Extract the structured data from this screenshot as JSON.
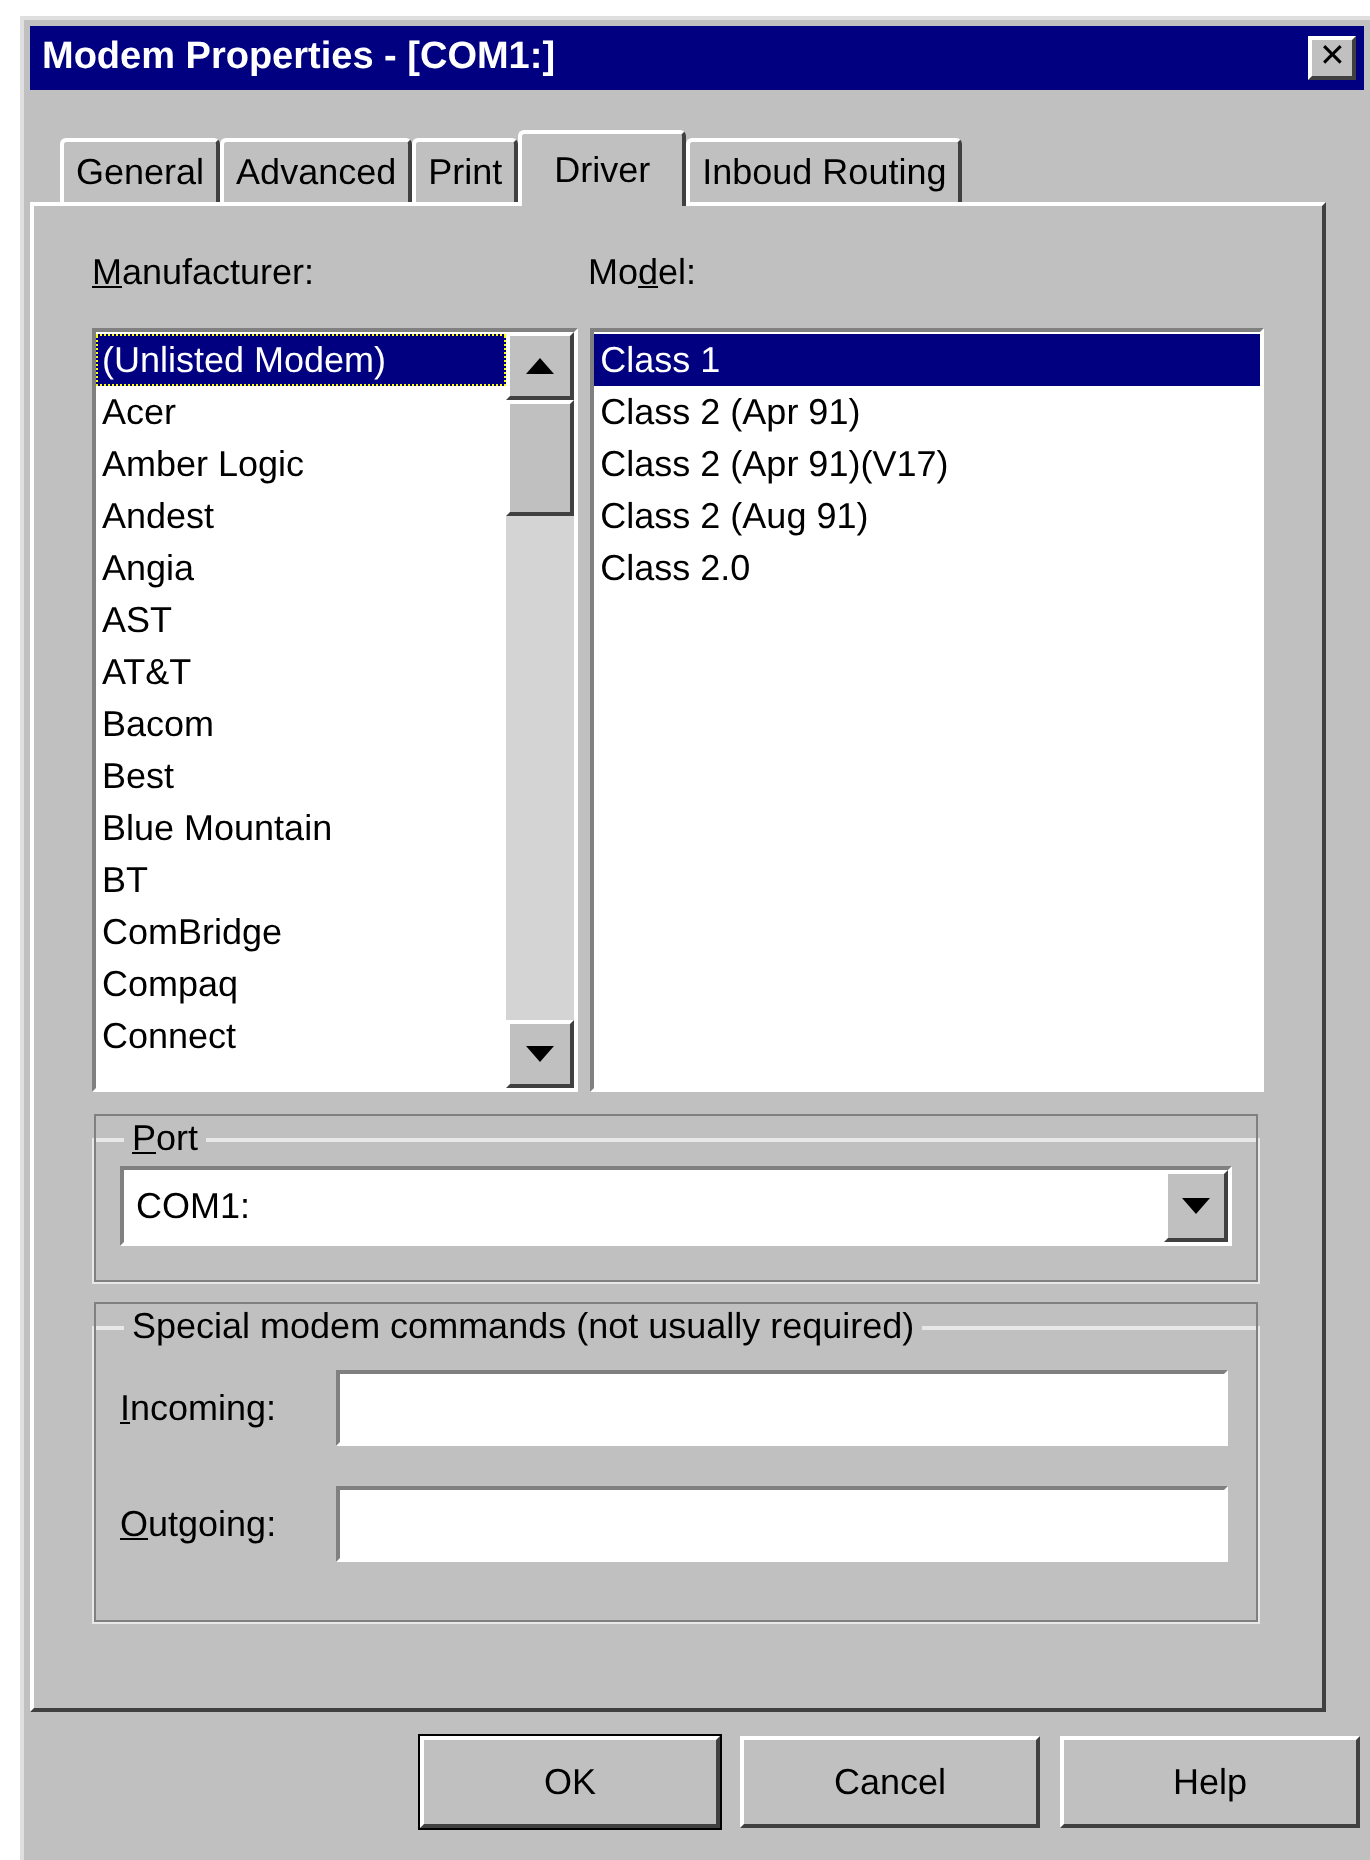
{
  "window": {
    "title": "Modem Properties - [COM1:]",
    "close_glyph": "✕"
  },
  "tabs": [
    {
      "label": "General",
      "selected": false
    },
    {
      "label": "Advanced",
      "selected": false
    },
    {
      "label": "Print",
      "selected": false
    },
    {
      "label": "Driver",
      "selected": true
    },
    {
      "label": "Inboud Routing",
      "selected": false
    }
  ],
  "manufacturer": {
    "access_key": "M",
    "label_rest": "anufacturer:",
    "items": [
      {
        "label": "(Unlisted Modem)",
        "selected": true
      },
      {
        "label": "Acer",
        "selected": false
      },
      {
        "label": "Amber Logic",
        "selected": false
      },
      {
        "label": "Andest",
        "selected": false
      },
      {
        "label": "Angia",
        "selected": false
      },
      {
        "label": "AST",
        "selected": false
      },
      {
        "label": "AT&T",
        "selected": false
      },
      {
        "label": "Bacom",
        "selected": false
      },
      {
        "label": "Best",
        "selected": false
      },
      {
        "label": "Blue Mountain",
        "selected": false
      },
      {
        "label": "BT",
        "selected": false
      },
      {
        "label": "ComBridge",
        "selected": false
      },
      {
        "label": "Compaq",
        "selected": false
      },
      {
        "label": "Connect",
        "selected": false
      }
    ]
  },
  "model": {
    "label_start": "Mo",
    "access_key": "d",
    "label_rest": "el:",
    "items": [
      {
        "label": "Class 1",
        "selected": true
      },
      {
        "label": "Class 2 (Apr 91)",
        "selected": false
      },
      {
        "label": "Class 2 (Apr 91)(V17)",
        "selected": false
      },
      {
        "label": "Class 2 (Aug 91)",
        "selected": false
      },
      {
        "label": "Class 2.0",
        "selected": false
      }
    ]
  },
  "port": {
    "access_key": "P",
    "label_rest": "ort",
    "value": "COM1:"
  },
  "special_commands": {
    "label": "Special modem commands (not usually required)",
    "fields": [
      {
        "access_key": "I",
        "label_rest": "ncoming:"
      },
      {
        "access_key": "O",
        "label_rest": "utgoing:"
      }
    ]
  },
  "buttons": [
    {
      "label": "OK",
      "default": true
    },
    {
      "label": "Cancel",
      "default": false
    },
    {
      "label": "Help",
      "default": false
    }
  ]
}
